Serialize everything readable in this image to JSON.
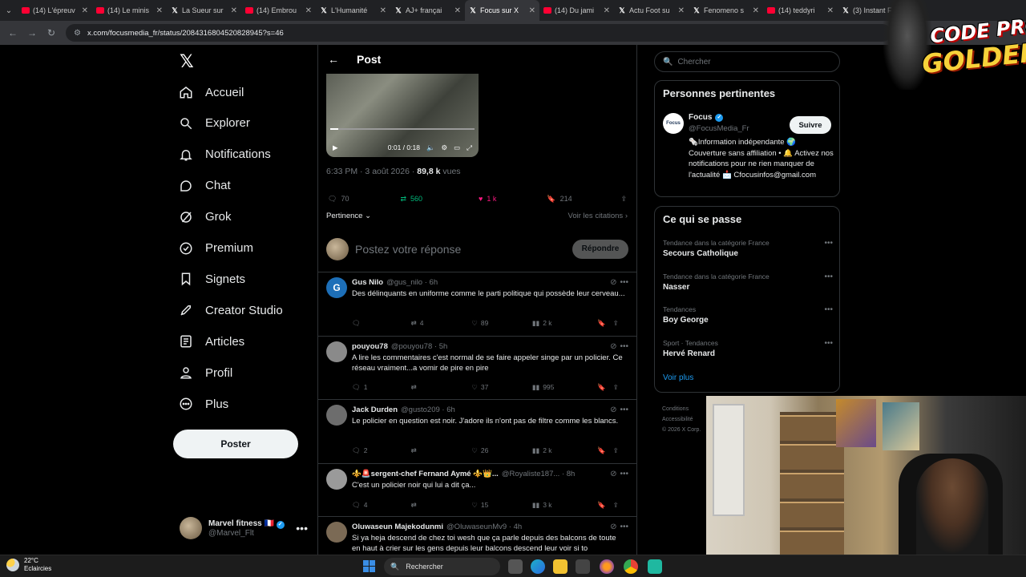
{
  "browser": {
    "tabs": [
      {
        "label": "(14) L'épreuv",
        "favicon": "youtube-icon"
      },
      {
        "label": "(14) Le minis",
        "favicon": "youtube-icon"
      },
      {
        "label": "La Sueur sur",
        "favicon": "x-icon"
      },
      {
        "label": "(14) Embrou",
        "favicon": "youtube-icon"
      },
      {
        "label": "L'Humanité",
        "favicon": "x-icon"
      },
      {
        "label": "AJ+ françai",
        "favicon": "x-icon"
      },
      {
        "label": "Focus sur X",
        "favicon": "x-icon",
        "active": true
      },
      {
        "label": "(14) Du jami",
        "favicon": "youtube-icon"
      },
      {
        "label": "Actu Foot su",
        "favicon": "x-icon"
      },
      {
        "label": "Fenomeno s",
        "favicon": "x-icon"
      },
      {
        "label": "(14) teddyri",
        "favicon": "youtube-icon"
      },
      {
        "label": "(3) Instant F",
        "favicon": "x-icon"
      }
    ],
    "url": "x.com/focusmedia_fr/status/2084316804520828945?s=46"
  },
  "overlay": {
    "line1": "CODE PROZIS",
    "line2": "GOLDENG"
  },
  "nav": {
    "items": [
      {
        "label": "Accueil",
        "icon": "home-icon"
      },
      {
        "label": "Explorer",
        "icon": "search-icon"
      },
      {
        "label": "Notifications",
        "icon": "bell-icon"
      },
      {
        "label": "Chat",
        "icon": "chat-icon"
      },
      {
        "label": "Grok",
        "icon": "grok-icon"
      },
      {
        "label": "Premium",
        "icon": "premium-icon"
      },
      {
        "label": "Signets",
        "icon": "bookmark-icon"
      },
      {
        "label": "Creator Studio",
        "icon": "rocket-icon"
      },
      {
        "label": "Articles",
        "icon": "article-icon"
      },
      {
        "label": "Profil",
        "icon": "person-icon"
      },
      {
        "label": "Plus",
        "icon": "more-circle-icon"
      }
    ],
    "post_button": "Poster",
    "account": {
      "name": "Marvel fitness 🇫🇷",
      "handle": "@Marvel_Flt"
    }
  },
  "post": {
    "header_title": "Post",
    "video": {
      "time": "0:01 / 0:18",
      "progress_fraction": 0.055
    },
    "timestamp": "6:33 PM · 3 août 2026 · ",
    "views": "89,8 k",
    "views_label": " vues",
    "stats": {
      "replies": "70",
      "reposts": "560",
      "likes": "1 k",
      "bookmarks": "214"
    },
    "sort_label": "Pertinence",
    "quotes_link": "Voir les citations",
    "reply_placeholder": "Postez votre réponse",
    "reply_button": "Répondre"
  },
  "replies": [
    {
      "name": "Gus Nilo",
      "handle": "@gus_nilo · 6h",
      "avatar_letter": "G",
      "avatar_color": "#1d6fb8",
      "text": "Des délinquants en uniforme comme le  parti politique qui possède leur cerveau...",
      "replies": "",
      "reposts": "4",
      "likes": "89",
      "views": "2 k"
    },
    {
      "name": "pouyou78",
      "handle": "@pouyou78 · 5h",
      "avatar_letter": "",
      "avatar_color": "#8a8a8a",
      "text": "A lire les commentaires c'est normal de se faire appeler singe par un policier. Ce réseau vraiment...a vomir de pire en pire",
      "replies": "1",
      "reposts": "",
      "likes": "37",
      "views": "995"
    },
    {
      "name": "Jack Durden",
      "handle": "@gusto209 · 6h",
      "avatar_letter": "",
      "avatar_color": "#6d6d6d",
      "text": "Le policier en question est noir. J'adore ils n'ont pas de filtre comme les blancs.",
      "replies": "2",
      "reposts": "",
      "likes": "26",
      "views": "2 k"
    },
    {
      "name": "⚜️🚨sergent-chef Fernand Aymé ⚜️👑...",
      "handle": "@Royaliste187... · 8h",
      "avatar_letter": "",
      "avatar_color": "#9a9a9a",
      "text": "C'est un policier noir qui lui a dit ça...",
      "replies": "4",
      "reposts": "",
      "likes": "15",
      "views": "3 k"
    },
    {
      "name": "Oluwaseun Majekodunmi",
      "handle": "@OluwaseunMv9 · 4h",
      "avatar_letter": "",
      "avatar_color": "#7b6a55",
      "text": "Si ya heja descend de chez toi wesh que ça parle depuis des balcons de toute en haut à crier sur les gens depuis leur balcons descend leur voir si to",
      "replies": "",
      "reposts": "",
      "likes": "",
      "views": ""
    }
  ],
  "right": {
    "search_placeholder": "Chercher",
    "relevant_title": "Personnes pertinentes",
    "profile": {
      "avatar_text": "Focus",
      "name": "Focus",
      "handle": "@FocusMedia_Fr",
      "follow": "Suivre",
      "bio": "🗞️Information indépendante 🌍 Couverture sans affiliation • 🔔 Activez nos notifications pour ne rien manquer de l'actualité 📩 Cfocusinfos@gmail.com"
    },
    "happening_title": "Ce qui se passe",
    "trends": [
      {
        "category": "Tendance dans la catégorie France",
        "name": "Secours Catholique"
      },
      {
        "category": "Tendance dans la catégorie France",
        "name": "Nasser"
      },
      {
        "category": "Tendances",
        "name": "Boy George"
      },
      {
        "category": "Sport · Tendances",
        "name": "Hervé Renard"
      }
    ],
    "see_more": "Voir plus",
    "footer": [
      "Conditions",
      "Accessibilité",
      "© 2026 X Corp."
    ]
  },
  "taskbar": {
    "weather_temp": "22°C",
    "weather_desc": "Eclaircies",
    "search_label": "Rechercher"
  }
}
